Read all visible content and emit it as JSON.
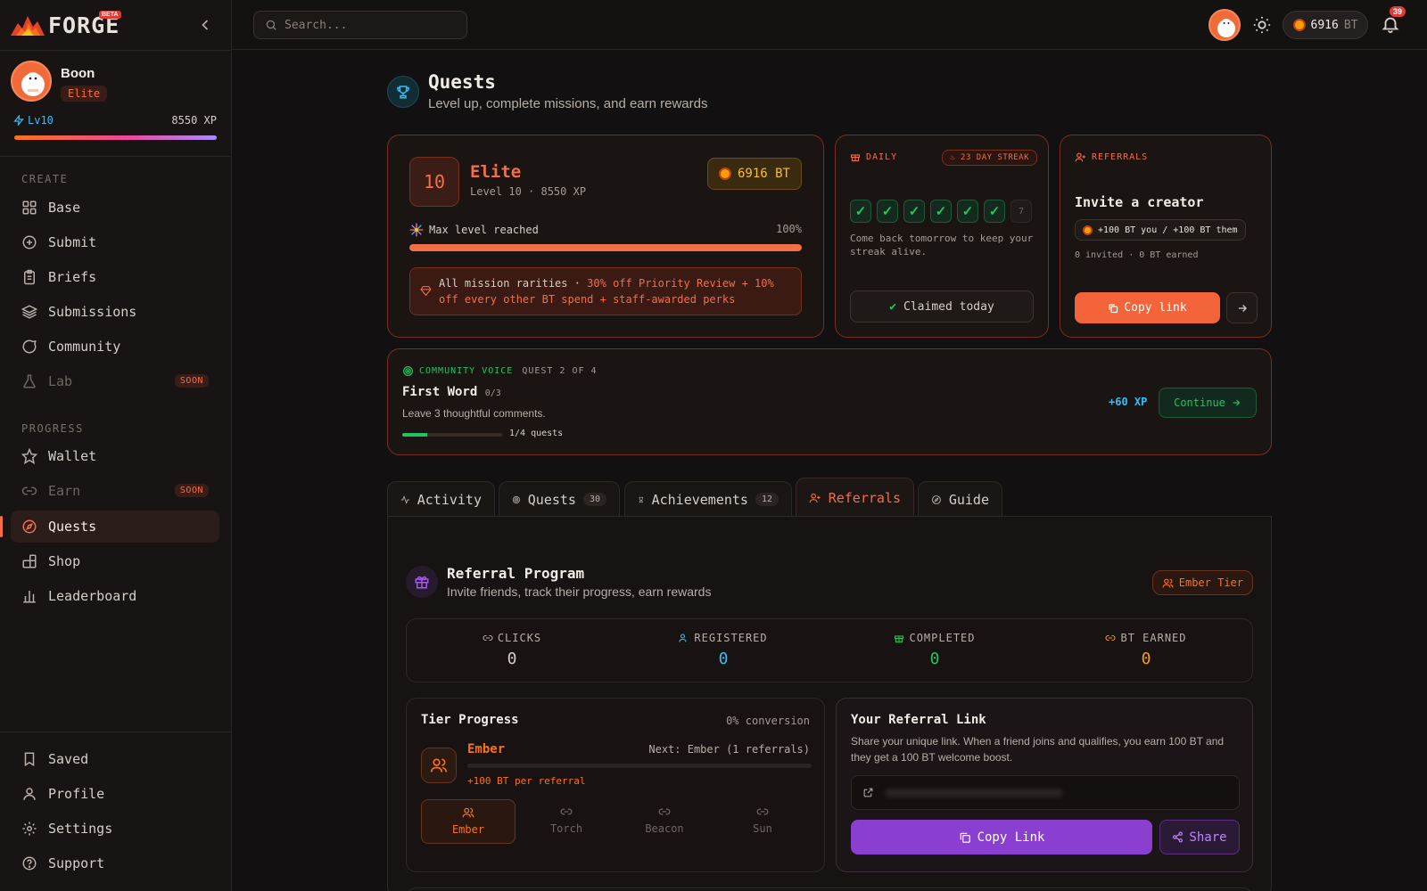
{
  "brand": {
    "name": "FORGE",
    "badge": "BETA"
  },
  "user": {
    "name": "Boon",
    "tier": "Elite",
    "level": "Lv10",
    "xp": "8550 XP",
    "xp_progress": 1.0
  },
  "sidebar": {
    "create_heading": "CREATE",
    "create_items": [
      {
        "label": "Base",
        "icon": "grid-icon"
      },
      {
        "label": "Submit",
        "icon": "plus-circle-icon"
      },
      {
        "label": "Briefs",
        "icon": "clipboard-icon"
      },
      {
        "label": "Submissions",
        "icon": "layers-icon"
      },
      {
        "label": "Community",
        "icon": "chat-bubble-icon"
      },
      {
        "label": "Lab",
        "icon": "flask-icon",
        "badge": "SOON"
      }
    ],
    "progress_heading": "PROGRESS",
    "progress_items": [
      {
        "label": "Wallet",
        "icon": "star-icon"
      },
      {
        "label": "Earn",
        "icon": "link-icon",
        "badge": "SOON"
      },
      {
        "label": "Quests",
        "icon": "compass-icon",
        "active": true
      },
      {
        "label": "Shop",
        "icon": "shop-grid-icon"
      },
      {
        "label": "Leaderboard",
        "icon": "bar-chart-icon"
      }
    ],
    "footer_items": [
      {
        "label": "Saved",
        "icon": "bookmark-icon"
      },
      {
        "label": "Profile",
        "icon": "user-icon"
      },
      {
        "label": "Settings",
        "icon": "gear-icon"
      },
      {
        "label": "Support",
        "icon": "help-circle-icon"
      }
    ]
  },
  "topbar": {
    "search_placeholder": "Search...",
    "balance": "6916",
    "balance_unit": "BT",
    "notifications": "39"
  },
  "page": {
    "title": "Quests",
    "subtitle": "Level up, complete missions, and earn rewards"
  },
  "elite_card": {
    "level": "10",
    "tier": "Elite",
    "sub": "Level 10 · 8550 XP",
    "balance": "6916 BT",
    "max_label": "Max level reached",
    "max_pct": "100%",
    "max_fill": 1.0,
    "perk_prefix": "All mission rarities · ",
    "perk_highlight": "30% off Priority Review + 10% off every other BT spend + staff-awarded perks"
  },
  "daily": {
    "heading": "DAILY",
    "streak": "23 DAY STREAK",
    "days_done": 6,
    "next_day": "7",
    "message": "Come back tomorrow to keep your streak alive.",
    "button": "Claimed today"
  },
  "referral_mini": {
    "heading": "REFERRALS",
    "title": "Invite a creator",
    "reward": "+100 BT you / +100 BT them",
    "stats": "0 invited · 0 BT earned",
    "copy_label": "Copy link"
  },
  "community_quest": {
    "category": "COMMUNITY VOICE",
    "position": "QUEST 2 OF 4",
    "title": "First Word",
    "count": "0/3",
    "desc": "Leave 3 thoughtful comments.",
    "progress_label": "1/4 quests",
    "progress_fill": 0.25,
    "reward": "+60 XP",
    "button": "Continue"
  },
  "tabs": [
    {
      "label": "Activity",
      "icon": "activity-icon"
    },
    {
      "label": "Quests",
      "icon": "target-icon",
      "count": "30"
    },
    {
      "label": "Achievements",
      "icon": "trophy-badge-icon",
      "count": "12"
    },
    {
      "label": "Referrals",
      "icon": "user-plus-icon",
      "active": true
    },
    {
      "label": "Guide",
      "icon": "compass-icon"
    }
  ],
  "referral_program": {
    "title": "Referral Program",
    "subtitle": "Invite friends, track their progress, earn rewards",
    "tier_badge": "Ember Tier",
    "stats": [
      {
        "label": "CLICKS",
        "value": "0",
        "color": "#d6cfc9"
      },
      {
        "label": "REGISTERED",
        "value": "0",
        "color": "#38bdf8"
      },
      {
        "label": "COMPLETED",
        "value": "0",
        "color": "#22c55e"
      },
      {
        "label": "BT EARNED",
        "value": "0",
        "color": "#f59e0b"
      }
    ],
    "tier_progress": {
      "title": "Tier Progress",
      "conversion": "0% conversion",
      "current": "Ember",
      "next": "Next: Ember (1 referrals)",
      "fill": 0.0,
      "rate": "+100 BT per referral",
      "tiers": [
        "Ember",
        "Torch",
        "Beacon",
        "Sun"
      ]
    },
    "link": {
      "title": "Your Referral Link",
      "desc": "Share your unique link. When a friend joins and qualifies, you earn 100 BT and they get a 100 BT welcome boost.",
      "copy_label": "Copy Link",
      "share_label": "Share"
    }
  },
  "colors": {
    "accent": "#f36f48",
    "green": "#22c55e",
    "blue": "#38bdf8",
    "purple": "#8b3fd1",
    "gold": "#f59e0b"
  }
}
